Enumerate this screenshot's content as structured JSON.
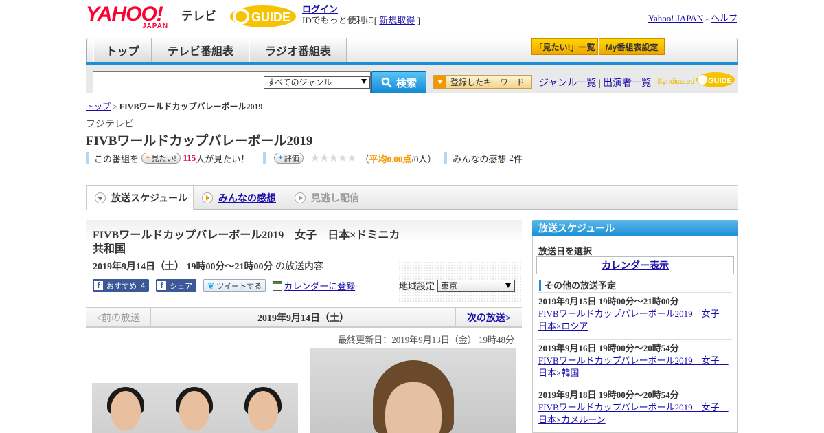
{
  "header": {
    "logo_text": "YAHOO!",
    "logo_sub": "JAPAN",
    "tv_label": "テレビ",
    "gguide_label": "GUIDE",
    "login_label": "ログイン",
    "login_note_prefix": "IDでもっと便利に[",
    "signup_label": "新規取得",
    "login_note_suffix": "]",
    "yahoo_japan_link": "Yahoo! JAPAN",
    "separator": "-",
    "help_link": "ヘルプ"
  },
  "nav": {
    "tabs": [
      "トップ",
      "テレビ番組表",
      "ラジオ番組表"
    ],
    "want_list_button": "「見たい!」一覧",
    "my_guide_button": "My番組表設定"
  },
  "search": {
    "input_value": "",
    "genre_selected": "すべてのジャンル",
    "search_button": "検索",
    "keyword_button": "登録したキーワード",
    "genre_list_link": "ジャンル一覧",
    "links_separator": "|",
    "performer_list_link": "出演者一覧",
    "syndicated_label": "Syndicated",
    "syndicated_brand": "GUIDE"
  },
  "breadcrumb": {
    "home": "トップ",
    "separator": ">",
    "current": "FIVBワールドカップバレーボール2019"
  },
  "program": {
    "channel": "フジテレビ",
    "title": "FIVBワールドカップバレーボール2019",
    "this_program_label": "この番組を",
    "want_button": "見たい!",
    "want_count": "115",
    "want_suffix": "人が見たい！",
    "rate_button": "評価",
    "stars": "★★★★★",
    "avg_prefix": "（",
    "avg_label": "平均0.00点",
    "avg_suffix": "/0人）",
    "impressions_label": "みんなの感想",
    "impressions_count": "2",
    "impressions_unit": "件"
  },
  "tabs": {
    "schedule": "放送スケジュール",
    "impressions": "みんなの感想",
    "missed": "見逃し配信"
  },
  "episode": {
    "title": "FIVBワールドカップバレーボール2019　女子　日本×ドミニカ共和国",
    "datetime": "2019年9月14日（土） 19時00分～21時00分",
    "datetime_suffix": "の放送内容",
    "fb_recommend": "おすすめ",
    "fb_count": "4",
    "fb_share": "シェア",
    "tweet": "ツイートする",
    "calendar_register": "カレンダーに登録",
    "region_label": "地域設定",
    "region_value": "東京",
    "prev_broadcast": "<前の放送",
    "current_date": "2019年9月14日（土）",
    "next_broadcast": "次の放送>",
    "last_updated": "最終更新日：2019年9月13日（金） 19時48分"
  },
  "sidebar": {
    "header": "放送スケジュール",
    "select_date": "放送日を選択",
    "calendar_button": "カレンダー表示",
    "other_header": "その他の放送予定",
    "schedule": [
      {
        "datetime": "2019年9月15日 19時00分～21時00分",
        "title": "FIVBワールドカップバレーボール2019　女子　日本×ロシア"
      },
      {
        "datetime": "2019年9月16日 19時00分～20時54分",
        "title": "FIVBワールドカップバレーボール2019　女子　日本×韓国"
      },
      {
        "datetime": "2019年9月18日 19時00分～20時54分",
        "title": "FIVBワールドカップバレーボール2019　女子　日本×カメルーン"
      }
    ]
  },
  "colors": {
    "accent_blue": "#1a8fd6",
    "yahoo_red": "#ff0033",
    "highlight_pink": "#e5004f",
    "highlight_orange": "#f39800"
  }
}
